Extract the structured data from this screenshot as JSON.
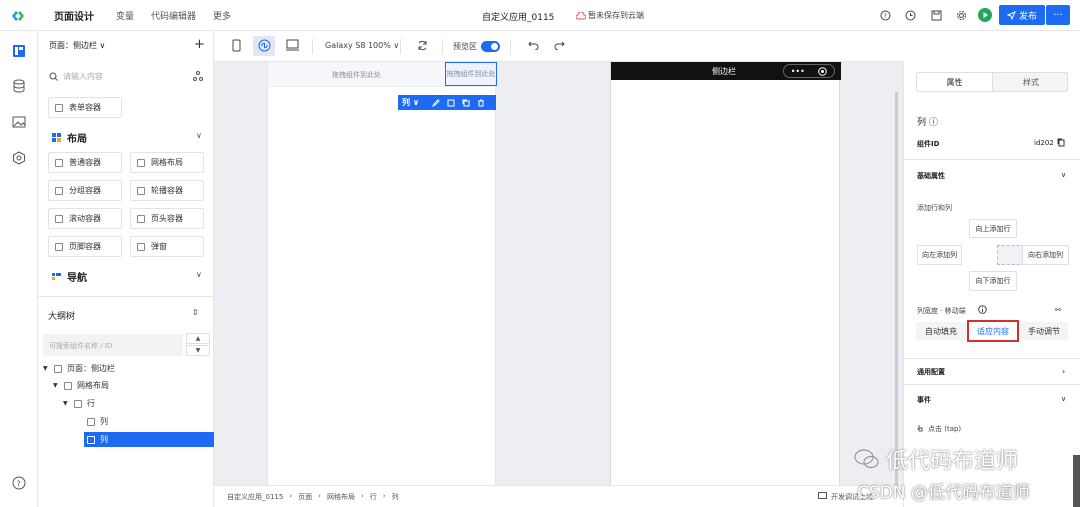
{
  "topbar": {
    "nav": [
      "页面设计",
      "变量",
      "代码编辑器",
      "更多"
    ],
    "app_title": "自定义应用_0115",
    "save_status": "暂未保存到云端",
    "publish_label": "发布",
    "more_label": "···"
  },
  "panel": {
    "page_selector": "页面：侧边栏 ∨",
    "add_label": "+",
    "search_placeholder": "请输入内容",
    "form_container": "表单容器",
    "layout": {
      "title": "布局",
      "items": [
        "普通容器",
        "网格布局",
        "分组容器",
        "轮播容器",
        "滚动容器",
        "页头容器",
        "页脚容器",
        "弹窗"
      ]
    },
    "nav_section": {
      "title": "导航"
    },
    "outline": {
      "title": "大纲树",
      "search_placeholder": "可搜索组件名称 / ID",
      "tree": [
        "页面：侧边栏",
        "网格布局",
        "行",
        "列",
        "列"
      ]
    }
  },
  "toolbar": {
    "device": "Galaxy S8 100% ∨",
    "preview_label": "预览区"
  },
  "canvas": {
    "drop_hint_1": "拖拽组件到此处",
    "drop_hint_2": "拖拽组件到此处",
    "col_toolbar_label": "列 ∨",
    "phone_title": "侧边栏",
    "capsule_dots": "•••"
  },
  "breadcrumb": [
    "自定义应用_0115",
    "›",
    "页面",
    "›",
    "网格布局",
    "›",
    "行",
    "›",
    "列"
  ],
  "dev_info": "开发调试上线",
  "props": {
    "tab_attr": "属性",
    "tab_style": "样式",
    "comp_name": "列 ⓘ",
    "comp_id_label": "组件ID",
    "comp_id_value": "id202",
    "basic_section": "基础属性",
    "add_rowcol_label": "添加行和列",
    "add_up": "向上添加行",
    "add_left": "向左添加列",
    "add_right": "向右添加列",
    "add_down": "向下添加行",
    "col_width_label": "列宽度 · 移动端",
    "width_options": [
      "自动填充",
      "适应内容",
      "手动调节"
    ],
    "common_section": "通用配置",
    "events_section": "事件",
    "event_tap": "点击 (tap)"
  },
  "watermark": {
    "line1": "低代码布道师",
    "line2": "CSDN @低代码布道师"
  },
  "colors": {
    "accent": "#1c6bf2",
    "highlight": "#d32f2f",
    "preview": "#23a55a"
  }
}
